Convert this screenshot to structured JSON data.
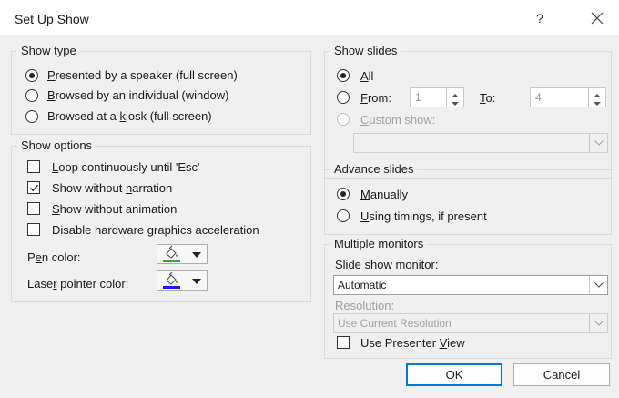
{
  "dialog": {
    "title": "Set Up Show",
    "help_label": "?"
  },
  "show_type": {
    "title": "Show type",
    "options": [
      {
        "pre": "",
        "key": "P",
        "post": "resented by a speaker (full screen)",
        "selected": true
      },
      {
        "pre": "",
        "key": "B",
        "post": "rowsed by an individual (window)",
        "selected": false
      },
      {
        "pre": "Browsed at a ",
        "key": "k",
        "post": "iosk (full screen)",
        "selected": false
      }
    ]
  },
  "show_options": {
    "title": "Show options",
    "checks": [
      {
        "pre": "",
        "key": "L",
        "post": "oop continuously until 'Esc'",
        "checked": false
      },
      {
        "pre": "Show without ",
        "key": "n",
        "post": "arration",
        "checked": true
      },
      {
        "pre": "",
        "key": "S",
        "post": "how without animation",
        "checked": false
      },
      {
        "pre": "Disable hardware ",
        "key": "g",
        "post": "raphics acceleration",
        "checked": false
      }
    ],
    "pen_color": {
      "pre": "P",
      "key": "e",
      "post": "n color:",
      "swatch": "#3aa33a"
    },
    "laser_color": {
      "pre": "Lase",
      "key": "r",
      "post": " pointer color:",
      "swatch": "#1c1cf0"
    }
  },
  "show_slides": {
    "title": "Show slides",
    "all": {
      "key": "A",
      "post": "ll",
      "selected": true
    },
    "from": {
      "key": "F",
      "post": "rom:",
      "value": "1",
      "selected": false
    },
    "to": {
      "key": "T",
      "post": "o:",
      "value": "4"
    },
    "custom": {
      "key": "C",
      "post": "ustom show:",
      "value": ""
    }
  },
  "advance_slides": {
    "title": "Advance slides",
    "manually": {
      "key": "M",
      "post": "anually",
      "selected": true
    },
    "timings": {
      "key": "U",
      "post": "sing timings, if present",
      "selected": false
    }
  },
  "monitors": {
    "title": "Multiple monitors",
    "monitor_label": {
      "pre": "Slide sh",
      "key": "o",
      "post": "w monitor:"
    },
    "monitor_value": "Automatic",
    "resolution_label": {
      "pre": "Resolu",
      "key": "t",
      "post": "ion:"
    },
    "resolution_value": "Use Current Resolution",
    "presenter": {
      "pre": "Use Presenter ",
      "key": "V",
      "post": "iew",
      "checked": false
    }
  },
  "buttons": {
    "ok": "OK",
    "cancel": "Cancel"
  }
}
